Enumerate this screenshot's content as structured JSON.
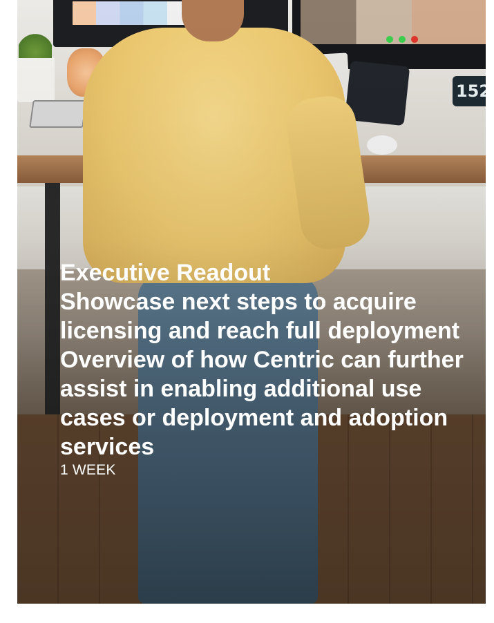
{
  "card": {
    "title": "Executive Readout",
    "items": [
      "Showcase next steps to acquire licensing and reach full deployment",
      "Overview of how Centric can further assist in enabling additional use cases or deployment and adoption services"
    ],
    "duration": "1 WEEK"
  },
  "photo": {
    "clock_digits": "152"
  }
}
